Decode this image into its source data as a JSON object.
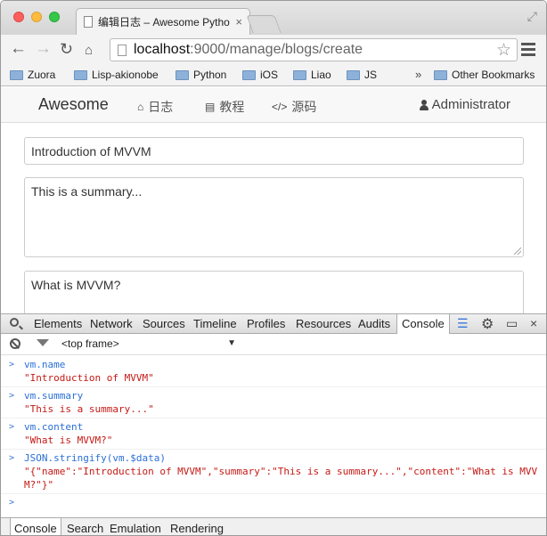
{
  "browser": {
    "tab_title": "编辑日志 – Awesome Pytho",
    "tab_close": "×",
    "url_host": "localhost",
    "url_path": ":9000/manage/blogs/create",
    "bookmarks": [
      "Zuora",
      "Lisp-akionobe",
      "Python",
      "iOS",
      "Liao",
      "JS"
    ],
    "bookmarks_more": "»",
    "other_bookmarks": "Other Bookmarks"
  },
  "navbar": {
    "brand": "Awesome",
    "links": [
      {
        "label": "日志",
        "icon": "home-icon",
        "glyph": "⌂"
      },
      {
        "label": "教程",
        "icon": "book-icon",
        "glyph": "▤"
      },
      {
        "label": "源码",
        "icon": "code-icon",
        "glyph": "</>"
      }
    ],
    "user": "Administrator"
  },
  "form": {
    "name": "Introduction of MVVM",
    "summary": "This is a summary...",
    "content": "What is MVVM?"
  },
  "devtools": {
    "tabs": [
      "Elements",
      "Network",
      "Sources",
      "Timeline",
      "Profiles",
      "Resources",
      "Audits",
      "Console"
    ],
    "active_tab": "Console",
    "frame": "<top frame>",
    "console": [
      {
        "cmd": "vm.name",
        "res": "\"Introduction of MVVM\""
      },
      {
        "cmd": "vm.summary",
        "res": "\"This is a summary...\""
      },
      {
        "cmd": "vm.content",
        "res": "\"What is MVVM?\""
      },
      {
        "cmd": "JSON.stringify(vm.$data)",
        "res": "\"{\"name\":\"Introduction of MVVM\",\"summary\":\"This is a summary...\",\"content\":\"What is MVVM?\"}\""
      }
    ],
    "drawer_tabs": [
      "Console",
      "Search",
      "Emulation",
      "Rendering"
    ]
  },
  "colors": {
    "command": "#2a6fd6",
    "result": "#c41a16"
  }
}
